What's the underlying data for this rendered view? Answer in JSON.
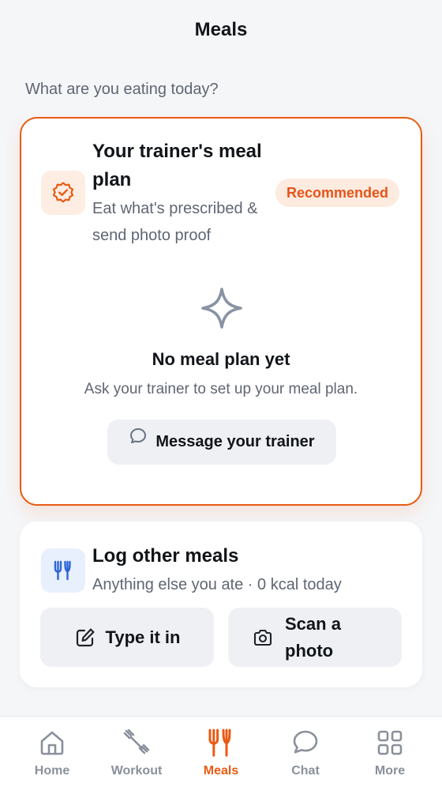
{
  "header": {
    "title": "Meals"
  },
  "prompt": "What are you eating today?",
  "trainer_plan": {
    "title": "Your trainer's meal plan",
    "subtitle": "Eat what's prescribed & send photo proof",
    "badge": "Recommended",
    "empty_title": "No meal plan yet",
    "empty_subtitle": "Ask your trainer to set up your meal plan.",
    "message_button": "Message your trainer"
  },
  "other_meals": {
    "title": "Log other meals",
    "subtitle": "Anything else you ate · 0 kcal today",
    "type_button": "Type it in",
    "scan_button": "Scan a photo"
  },
  "tabs": [
    {
      "label": "Home",
      "icon": "home-icon",
      "active": false
    },
    {
      "label": "Workout",
      "icon": "dumbbell-icon",
      "active": false
    },
    {
      "label": "Meals",
      "icon": "fork-knife-icon",
      "active": true
    },
    {
      "label": "Chat",
      "icon": "chat-bubble-icon",
      "active": false
    },
    {
      "label": "More",
      "icon": "grid-icon",
      "active": false
    }
  ],
  "colors": {
    "accent": "#EA5A13",
    "badge_bg": "#FDEBDF",
    "blue_icon": "#2F64D8",
    "muted_text": "#5F6673",
    "button_bg": "#EEF0F3"
  }
}
